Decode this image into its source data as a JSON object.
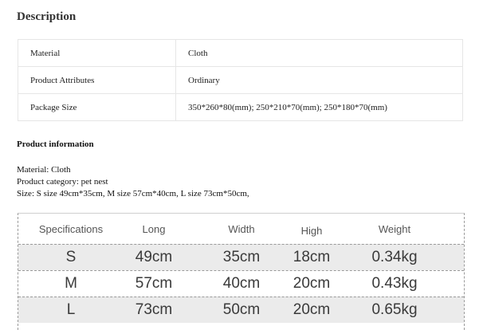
{
  "description": {
    "title": "Description",
    "rows": [
      {
        "label": "Material",
        "value": "Cloth"
      },
      {
        "label": "Product Attributes",
        "value": "Ordinary"
      },
      {
        "label": "Package Size",
        "value": "350*260*80(mm); 250*210*70(mm); 250*180*70(mm)"
      }
    ]
  },
  "product_info": {
    "title": "Product information",
    "lines": [
      "Material: Cloth",
      "Product category: pet nest",
      "Size: S size 49cm*35cm, M size 57cm*40cm, L size 73cm*50cm,"
    ]
  },
  "spec_table": {
    "headers": [
      "Specifications",
      "Long",
      "Width",
      "High",
      "Weight"
    ],
    "rows": [
      [
        "S",
        "49cm",
        "35cm",
        "18cm",
        "0.34kg"
      ],
      [
        "M",
        "57cm",
        "40cm",
        "20cm",
        "0.43kg"
      ],
      [
        "L",
        "73cm",
        "50cm",
        "20cm",
        "0.65kg"
      ]
    ]
  }
}
